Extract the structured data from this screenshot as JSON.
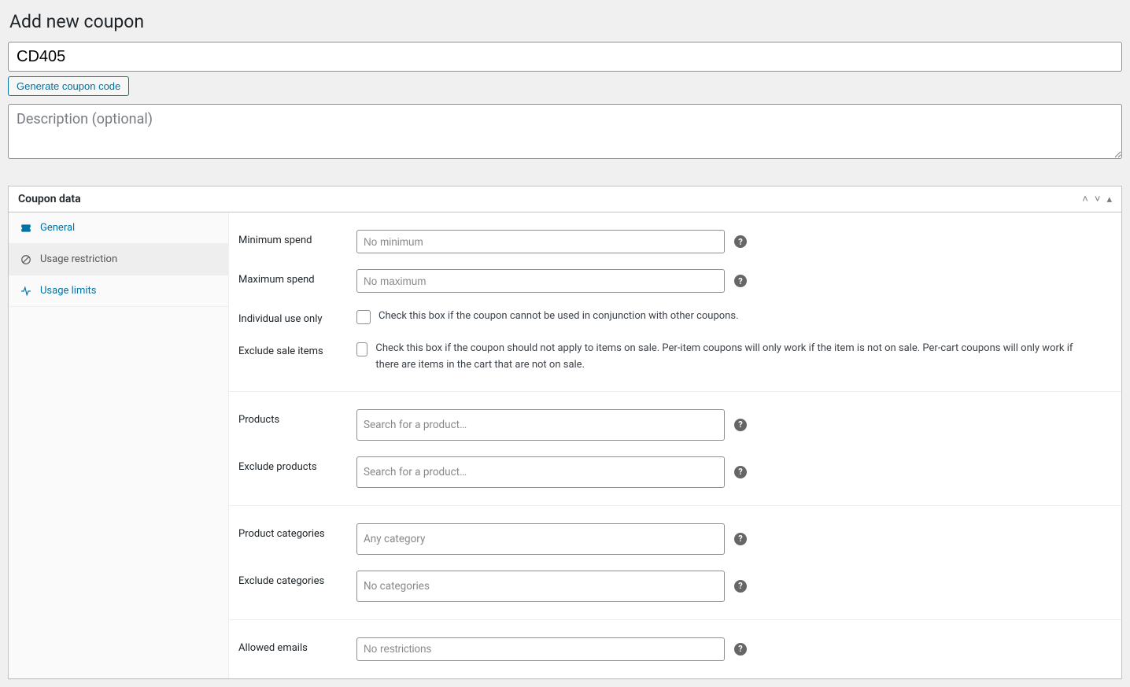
{
  "page": {
    "title": "Add new coupon"
  },
  "coupon": {
    "code": "CD405",
    "generate_button": "Generate coupon code",
    "description_placeholder": "Description (optional)"
  },
  "metabox": {
    "title": "Coupon data",
    "tabs": {
      "general": "General",
      "usage_restriction": "Usage restriction",
      "usage_limits": "Usage limits"
    }
  },
  "fields": {
    "min_spend": {
      "label": "Minimum spend",
      "placeholder": "No minimum"
    },
    "max_spend": {
      "label": "Maximum spend",
      "placeholder": "No maximum"
    },
    "individual_use": {
      "label": "Individual use only",
      "desc": "Check this box if the coupon cannot be used in conjunction with other coupons."
    },
    "exclude_sale": {
      "label": "Exclude sale items",
      "desc": "Check this box if the coupon should not apply to items on sale. Per-item coupons will only work if the item is not on sale. Per-cart coupons will only work if there are items in the cart that are not on sale."
    },
    "products": {
      "label": "Products",
      "placeholder": "Search for a product…"
    },
    "exclude_products": {
      "label": "Exclude products",
      "placeholder": "Search for a product…"
    },
    "product_categories": {
      "label": "Product categories",
      "placeholder": "Any category"
    },
    "exclude_categories": {
      "label": "Exclude categories",
      "placeholder": "No categories"
    },
    "allowed_emails": {
      "label": "Allowed emails",
      "placeholder": "No restrictions"
    }
  }
}
